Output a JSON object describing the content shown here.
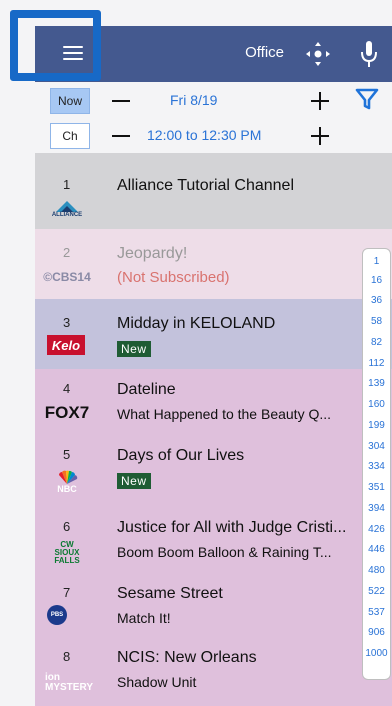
{
  "header": {
    "location": "Office",
    "colors": {
      "bar": "#44598f",
      "highlight": "#1769c7"
    }
  },
  "controls": {
    "now_label": "Now",
    "ch_label": "Ch",
    "date": "Fri 8/19",
    "time_range": "12:00 to 12:30 PM"
  },
  "channels": [
    {
      "number": "1",
      "logo": "ALLIANCE",
      "title": "Alliance Tutorial Channel",
      "subtitle": "",
      "badge": "",
      "bg": "#d3d3d6"
    },
    {
      "number": "2",
      "logo": "©CBS14",
      "title": "Jeopardy!",
      "subtitle": "(Not Subscribed)",
      "badge": "",
      "bg": "#eedde8"
    },
    {
      "number": "3",
      "logo": "Kelo",
      "title": "Midday in KELOLAND",
      "subtitle": "",
      "badge": "New",
      "bg": "#c3c2dc"
    },
    {
      "number": "4",
      "logo": "FOX7",
      "title": "Dateline",
      "subtitle": "What Happened to the Beauty Q...",
      "badge": "",
      "bg": "#dfc0dc"
    },
    {
      "number": "5",
      "logo": "NBC",
      "title": "Days of Our Lives",
      "subtitle": "",
      "badge": "New",
      "bg": "#dfc0dc"
    },
    {
      "number": "6",
      "logo": "CW SIOUX FALLS",
      "title": "Justice for All with Judge Cristi...",
      "subtitle": "Boom Boom Balloon & Raining T...",
      "badge": "",
      "bg": "#dfc0dc"
    },
    {
      "number": "7",
      "logo": "PBS",
      "title": "Sesame Street",
      "subtitle": "Match It!",
      "badge": "",
      "bg": "#dfc0dc"
    },
    {
      "number": "8",
      "logo": "ion MYSTERY",
      "title": "NCIS: New Orleans",
      "subtitle": "Shadow Unit",
      "badge": "",
      "bg": "#dfc0dc"
    }
  ],
  "quick_jump": [
    "1",
    "16",
    "36",
    "58",
    "82",
    "112",
    "139",
    "160",
    "199",
    "304",
    "334",
    "351",
    "394",
    "426",
    "446",
    "480",
    "522",
    "537",
    "906",
    "1000"
  ]
}
